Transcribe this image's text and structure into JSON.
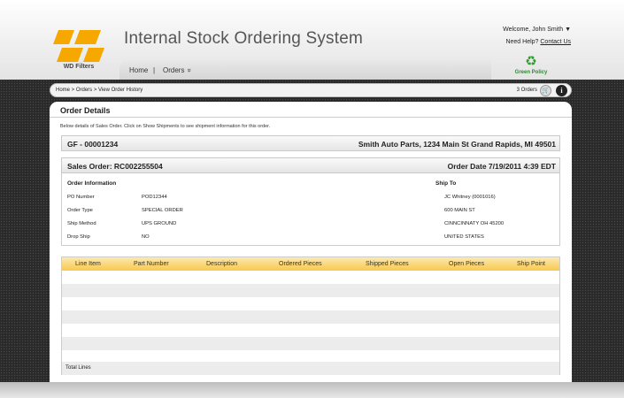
{
  "header": {
    "logo_text": "WD Filters",
    "app_title": "Internal Stock Ordering System",
    "nav": {
      "home": "Home",
      "separator": "|",
      "orders": "Orders",
      "orders_chevron": "»"
    },
    "welcome": "Welcome, John Smith ▼",
    "help_prefix": "Need Help?",
    "help_link": "Contact Us",
    "green_policy": "Green Policy",
    "recycle_symbol": "♻"
  },
  "breadcrumb": {
    "text": "Home > Orders > View Order History",
    "orders_count": "3 Orders",
    "cart_icon": "cart-icon",
    "cart_glyph": "🛒",
    "info_glyph": "i"
  },
  "panel": {
    "title": "Order Details",
    "intro": "Below details of Sales Order. Click on Show Shipments to see shipment information for this order."
  },
  "gf_bar": {
    "left": "GF - 00001234",
    "right": "Smith Auto Parts, 1234 Main St Grand Rapids, MI 49501"
  },
  "so_bar": {
    "left": "Sales Order: RC002255504",
    "right": "Order Date 7/19/2011 4:39 EDT"
  },
  "order_info": {
    "heading": "Order Information",
    "rows": [
      {
        "label": "PO Number",
        "value": "POD12344"
      },
      {
        "label": "Order Type",
        "value": "SPECIAL ORDER"
      },
      {
        "label": "Ship Method",
        "value": "UPS GROUND"
      },
      {
        "label": "Drop Ship",
        "value": "NO"
      }
    ]
  },
  "ship_to": {
    "heading": "Ship To",
    "lines": [
      "JC Whitney (0001016)",
      "600 MAIN ST",
      "CINNCINNATY OH 45200",
      "UNITED STATES"
    ]
  },
  "grid": {
    "columns": [
      "Line Item",
      "Part Number",
      "Description",
      "Ordered Pieces",
      "Shipped Pieces",
      "Open Pieces",
      "Ship Point"
    ],
    "total_label": "Total Lines"
  },
  "colors": {
    "accent": "#f7b500",
    "grid_header": "#f7c84d",
    "green": "#2f8a2f"
  }
}
